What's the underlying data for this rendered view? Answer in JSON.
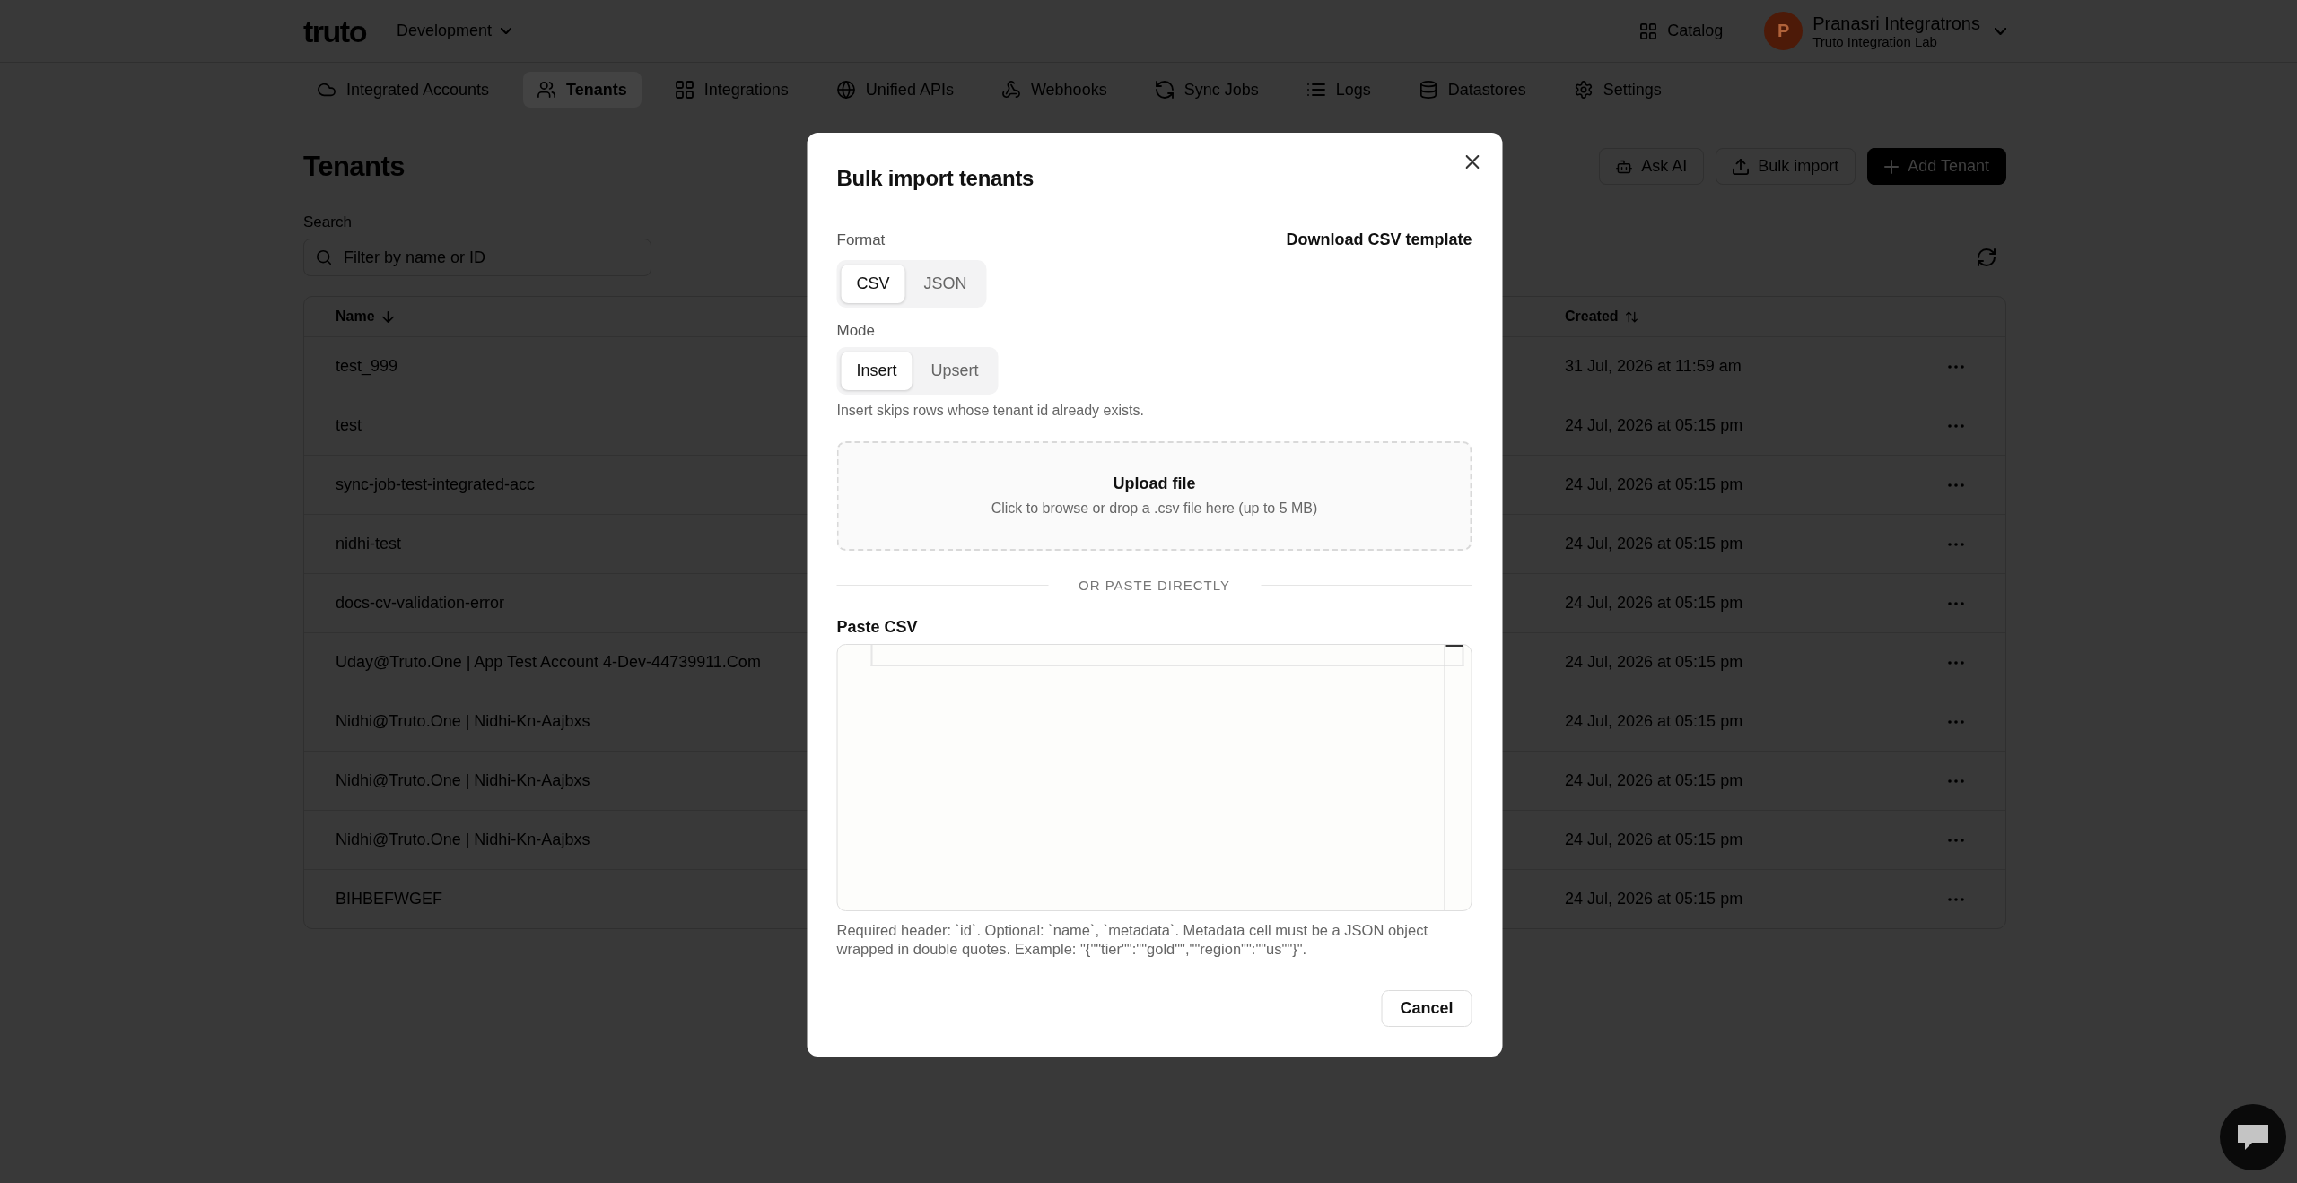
{
  "header": {
    "logo": "truto",
    "environment": "Development",
    "catalog": "Catalog",
    "user": {
      "initial": "P",
      "name": "Pranasri Integratrons",
      "org": "Truto Integration Lab"
    }
  },
  "nav_tabs": [
    {
      "label": "Integrated Accounts",
      "selected": false
    },
    {
      "label": "Tenants",
      "selected": true
    },
    {
      "label": "Integrations",
      "selected": false
    },
    {
      "label": "Unified APIs",
      "selected": false
    },
    {
      "label": "Webhooks",
      "selected": false
    },
    {
      "label": "Sync Jobs",
      "selected": false
    },
    {
      "label": "Logs",
      "selected": false
    },
    {
      "label": "Datastores",
      "selected": false
    },
    {
      "label": "Settings",
      "selected": false
    }
  ],
  "page": {
    "title": "Tenants",
    "actions": [
      {
        "label": "Ask AI",
        "kind": "secondary"
      },
      {
        "label": "Bulk import",
        "kind": "secondary"
      },
      {
        "label": "Add Tenant",
        "kind": "primary"
      }
    ],
    "search": {
      "label": "Search",
      "placeholder": "Filter by name or ID"
    }
  },
  "table": {
    "columns": [
      {
        "label": "Name",
        "sorted": true
      },
      {
        "label": "Created",
        "sorted": false
      }
    ],
    "rows": [
      {
        "name": "test_999",
        "created": "31 Jul, 2026 at 11:59 am"
      },
      {
        "name": "test",
        "created": "24 Jul, 2026 at 05:15 pm"
      },
      {
        "name": "sync-job-test-integrated-acc",
        "created": "24 Jul, 2026 at 05:15 pm"
      },
      {
        "name": "nidhi-test",
        "created": "24 Jul, 2026 at 05:15 pm"
      },
      {
        "name": "docs-cv-validation-error",
        "created": "24 Jul, 2026 at 05:15 pm"
      },
      {
        "name": "Uday@Truto.One | App Test Account 4-Dev-44739911.Com",
        "created": "24 Jul, 2026 at 05:15 pm"
      },
      {
        "name": "Nidhi@Truto.One | Nidhi-Kn-Aajbxs",
        "created": "24 Jul, 2026 at 05:15 pm"
      },
      {
        "name": "Nidhi@Truto.One | Nidhi-Kn-Aajbxs",
        "created": "24 Jul, 2026 at 05:15 pm"
      },
      {
        "name": "Nidhi@Truto.One | Nidhi-Kn-Aajbxs",
        "created": "24 Jul, 2026 at 05:15 pm"
      },
      {
        "name": "BIHBEFWGEF",
        "created": "24 Jul, 2026 at 05:15 pm"
      }
    ]
  },
  "dialog": {
    "title": "Bulk import tenants",
    "template_link": "Download CSV template",
    "format": {
      "label": "Format",
      "options": [
        {
          "label": "CSV",
          "selected": true
        },
        {
          "label": "JSON",
          "selected": false
        }
      ]
    },
    "mode": {
      "label": "Mode",
      "options": [
        {
          "label": "Insert",
          "selected": true
        },
        {
          "label": "Upsert",
          "selected": false
        }
      ],
      "hint": "Insert skips rows whose tenant id already exists."
    },
    "upload": {
      "title": "Upload file",
      "subtitle": "Click to browse or drop a .csv file here (up to 5 MB)"
    },
    "divider": "OR PASTE DIRECTLY",
    "paste": {
      "label": "Paste CSV",
      "help": "Required header: `id`. Optional: `name`, `metadata`. Metadata cell must be a JSON object wrapped in double quotes. Example: \"{\"\"tier\"\":\"\"gold\"\",\"\"region\"\":\"\"us\"\"}\"."
    },
    "buttons": [
      {
        "label": "Cancel"
      }
    ]
  }
}
